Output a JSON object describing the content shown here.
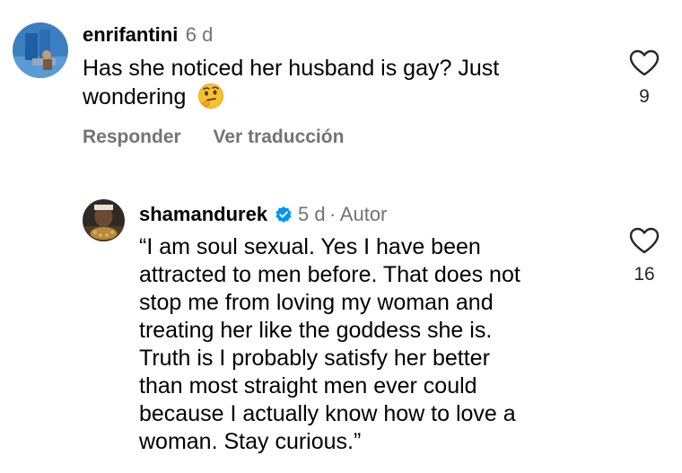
{
  "comments": [
    {
      "username": "enrifantini",
      "time": "6 d",
      "text_line1": "Has she noticed her husband is gay? Just",
      "text_line2": "wondering",
      "emoji_icon": "thinking-face-icon",
      "likes": "9",
      "reply_label": "Responder",
      "translate_label": "Ver traducción"
    },
    {
      "username": "shamandurek",
      "verified_icon": "verified-badge-icon",
      "time": "5 d",
      "separator": "·",
      "author_label": "Autor",
      "text_lines": [
        "“I am soul sexual. Yes I have been",
        "attracted to men before. That does not",
        "stop me from loving my woman and",
        "treating her like the goddess she is.",
        "Truth is I probably satisfy her better",
        "than most straight men ever could",
        "because I actually know how to love a",
        "woman. Stay curious.”"
      ],
      "likes": "16"
    }
  ],
  "colors": {
    "secondary_text": "#737373",
    "verified_blue": "#0095f6"
  }
}
